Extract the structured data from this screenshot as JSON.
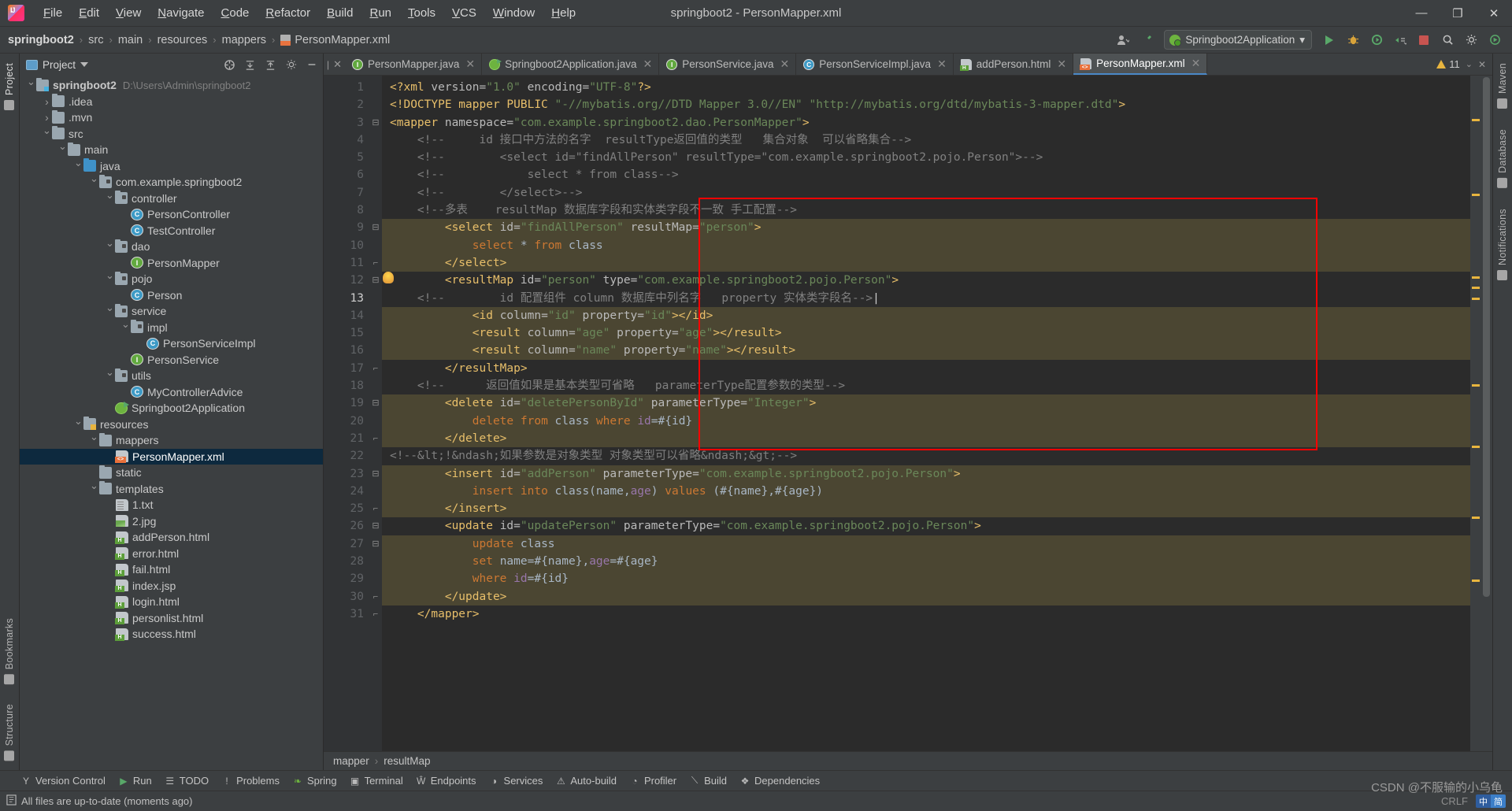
{
  "window": {
    "title": "springboot2 - PersonMapper.xml",
    "minimize": "—",
    "maximize": "❐",
    "close": "✕"
  },
  "menu": [
    "File",
    "Edit",
    "View",
    "Navigate",
    "Code",
    "Refactor",
    "Build",
    "Run",
    "Tools",
    "VCS",
    "Window",
    "Help"
  ],
  "breadcrumb": {
    "items": [
      "springboot2",
      "src",
      "main",
      "resources",
      "mappers",
      "PersonMapper.xml"
    ],
    "separator": "›"
  },
  "run_config": {
    "label": "Springboot2Application",
    "caret": "▾"
  },
  "project_pane": {
    "title": "Project",
    "caret": "▾",
    "tree": [
      {
        "depth": 0,
        "arrow": "down",
        "icon": "module",
        "label": "springboot2",
        "sub": "D:\\Users\\Admin\\springboot2",
        "bold": true
      },
      {
        "depth": 1,
        "arrow": "right",
        "icon": "folder",
        "label": ".idea"
      },
      {
        "depth": 1,
        "arrow": "right",
        "icon": "folder",
        "label": ".mvn"
      },
      {
        "depth": 1,
        "arrow": "down",
        "icon": "folder",
        "label": "src"
      },
      {
        "depth": 2,
        "arrow": "down",
        "icon": "folder",
        "label": "main"
      },
      {
        "depth": 3,
        "arrow": "down",
        "icon": "folder-blue",
        "label": "java"
      },
      {
        "depth": 4,
        "arrow": "down",
        "icon": "package",
        "label": "com.example.springboot2"
      },
      {
        "depth": 5,
        "arrow": "down",
        "icon": "package",
        "label": "controller"
      },
      {
        "depth": 6,
        "arrow": "none",
        "icon": "class",
        "label": "PersonController"
      },
      {
        "depth": 6,
        "arrow": "none",
        "icon": "class",
        "label": "TestController"
      },
      {
        "depth": 5,
        "arrow": "down",
        "icon": "package",
        "label": "dao"
      },
      {
        "depth": 6,
        "arrow": "none",
        "icon": "interface",
        "label": "PersonMapper"
      },
      {
        "depth": 5,
        "arrow": "down",
        "icon": "package",
        "label": "pojo"
      },
      {
        "depth": 6,
        "arrow": "none",
        "icon": "class",
        "label": "Person"
      },
      {
        "depth": 5,
        "arrow": "down",
        "icon": "package",
        "label": "service"
      },
      {
        "depth": 6,
        "arrow": "down",
        "icon": "package",
        "label": "impl"
      },
      {
        "depth": 7,
        "arrow": "none",
        "icon": "class",
        "label": "PersonServiceImpl"
      },
      {
        "depth": 6,
        "arrow": "none",
        "icon": "interface",
        "label": "PersonService"
      },
      {
        "depth": 5,
        "arrow": "down",
        "icon": "package",
        "label": "utils"
      },
      {
        "depth": 6,
        "arrow": "none",
        "icon": "class",
        "label": "MyControllerAdvice"
      },
      {
        "depth": 5,
        "arrow": "none",
        "icon": "spring",
        "label": "Springboot2Application"
      },
      {
        "depth": 3,
        "arrow": "down",
        "icon": "resources",
        "label": "resources"
      },
      {
        "depth": 4,
        "arrow": "down",
        "icon": "folder",
        "label": "mappers"
      },
      {
        "depth": 5,
        "arrow": "none",
        "icon": "xml",
        "label": "PersonMapper.xml",
        "selected": true
      },
      {
        "depth": 4,
        "arrow": "none",
        "icon": "folder",
        "label": "static"
      },
      {
        "depth": 4,
        "arrow": "down",
        "icon": "folder",
        "label": "templates"
      },
      {
        "depth": 5,
        "arrow": "none",
        "icon": "txt",
        "label": "1.txt"
      },
      {
        "depth": 5,
        "arrow": "none",
        "icon": "jpg",
        "label": "2.jpg"
      },
      {
        "depth": 5,
        "arrow": "none",
        "icon": "html",
        "label": "addPerson.html"
      },
      {
        "depth": 5,
        "arrow": "none",
        "icon": "html",
        "label": "error.html"
      },
      {
        "depth": 5,
        "arrow": "none",
        "icon": "html",
        "label": "fail.html"
      },
      {
        "depth": 5,
        "arrow": "none",
        "icon": "html",
        "label": "index.jsp"
      },
      {
        "depth": 5,
        "arrow": "none",
        "icon": "html",
        "label": "login.html"
      },
      {
        "depth": 5,
        "arrow": "none",
        "icon": "html",
        "label": "personlist.html"
      },
      {
        "depth": 5,
        "arrow": "none",
        "icon": "html",
        "label": "success.html"
      }
    ]
  },
  "left_rail": {
    "project": "Project",
    "bookmarks": "Bookmarks",
    "structure": "Structure"
  },
  "right_rail": {
    "maven": "Maven",
    "database": "Database",
    "notifications": "Notifications"
  },
  "tabs": [
    {
      "label": "PersonMapper.java",
      "icon": "interface",
      "icon_letter": "I",
      "active": false
    },
    {
      "label": "Springboot2Application.java",
      "icon": "spring",
      "icon_letter": "",
      "active": false
    },
    {
      "label": "PersonService.java",
      "icon": "interface",
      "icon_letter": "I",
      "active": false
    },
    {
      "label": "PersonServiceImpl.java",
      "icon": "class",
      "icon_letter": "C",
      "active": false
    },
    {
      "label": "addPerson.html",
      "icon": "html",
      "icon_letter": "",
      "active": false
    },
    {
      "label": "PersonMapper.xml",
      "icon": "xml",
      "icon_letter": "",
      "active": true
    }
  ],
  "inspection": {
    "warning_count": "11",
    "close": "✕"
  },
  "editor_breadcrumb": {
    "items": [
      "mapper",
      "resultMap"
    ],
    "separator": "›"
  },
  "code": {
    "first_line": 1,
    "lines": [
      {
        "n": 1,
        "fold": "",
        "hl": false,
        "tokens": [
          {
            "t": "<?xml ",
            "c": "c-doct"
          },
          {
            "t": "version=",
            "c": "c-attr"
          },
          {
            "t": "\"1.0\"",
            "c": "c-val"
          },
          {
            "t": " encoding=",
            "c": "c-attr"
          },
          {
            "t": "\"UTF-8\"",
            "c": "c-val"
          },
          {
            "t": "?>",
            "c": "c-doct"
          }
        ]
      },
      {
        "n": 2,
        "fold": "",
        "hl": false,
        "tokens": [
          {
            "t": "<!DOCTYPE mapper PUBLIC ",
            "c": "c-doct"
          },
          {
            "t": "\"-//mybatis.org//DTD Mapper 3.0//EN\"",
            "c": "c-val"
          },
          {
            "t": " ",
            "c": "c-plain"
          },
          {
            "t": "\"http://mybatis.org/dtd/mybatis-3-mapper.dtd\"",
            "c": "c-val"
          },
          {
            "t": ">",
            "c": "c-doct"
          }
        ]
      },
      {
        "n": 3,
        "fold": "start",
        "hl": false,
        "tokens": [
          {
            "t": "<mapper ",
            "c": "c-tag"
          },
          {
            "t": "namespace=",
            "c": "c-attr"
          },
          {
            "t": "\"com.example.springboot2.dao.PersonMapper\"",
            "c": "c-val"
          },
          {
            "t": ">",
            "c": "c-tag"
          }
        ]
      },
      {
        "n": 4,
        "fold": "",
        "hl": false,
        "tokens": [
          {
            "t": "    <!--     id 接口中方法的名字  resultType返回值的类型   集合对象  可以省略集合-->",
            "c": "c-com"
          }
        ]
      },
      {
        "n": 5,
        "fold": "",
        "hl": false,
        "tokens": [
          {
            "t": "    <!--        <select id=\"findAllPerson\" resultType=\"com.example.springboot2.pojo.Person\">-->",
            "c": "c-com"
          }
        ]
      },
      {
        "n": 6,
        "fold": "",
        "hl": false,
        "tokens": [
          {
            "t": "    <!--            select * from class-->",
            "c": "c-com"
          }
        ]
      },
      {
        "n": 7,
        "fold": "",
        "hl": false,
        "tokens": [
          {
            "t": "    <!--        </select>-->",
            "c": "c-com"
          }
        ]
      },
      {
        "n": 8,
        "fold": "",
        "hl": false,
        "tokens": [
          {
            "t": "    <!--多表    resultMap 数据库字段和实体类字段不一致 手工配置-->",
            "c": "c-com"
          }
        ]
      },
      {
        "n": 9,
        "fold": "start",
        "hl": true,
        "indent": 8,
        "tokens": [
          {
            "t": "<select ",
            "c": "c-tag"
          },
          {
            "t": "id=",
            "c": "c-attr"
          },
          {
            "t": "\"findAllPerson\"",
            "c": "c-val"
          },
          {
            "t": " resultMap=",
            "c": "c-attr"
          },
          {
            "t": "\"person\"",
            "c": "c-val"
          },
          {
            "t": ">",
            "c": "c-tag"
          }
        ]
      },
      {
        "n": 10,
        "fold": "",
        "hl": true,
        "indent": 12,
        "tokens": [
          {
            "t": "select ",
            "c": "c-sql"
          },
          {
            "t": "* ",
            "c": "c-plain"
          },
          {
            "t": "from ",
            "c": "c-sql"
          },
          {
            "t": "class",
            "c": "c-plain"
          }
        ]
      },
      {
        "n": 11,
        "fold": "end",
        "hl": true,
        "indent": 8,
        "tokens": [
          {
            "t": "</select>",
            "c": "c-tag"
          }
        ]
      },
      {
        "n": 12,
        "fold": "start",
        "hl": false,
        "indent": 8,
        "bulb": true,
        "tokens": [
          {
            "t": "<resultMap ",
            "c": "c-tag"
          },
          {
            "t": "id=",
            "c": "c-attr"
          },
          {
            "t": "\"person\"",
            "c": "c-val"
          },
          {
            "t": " type=",
            "c": "c-attr"
          },
          {
            "t": "\"com.example.springboot2.pojo.Person\"",
            "c": "c-val"
          },
          {
            "t": ">",
            "c": "c-tag"
          }
        ]
      },
      {
        "n": 13,
        "fold": "",
        "hl": false,
        "caret": true,
        "tokens": [
          {
            "t": "    <!--        id 配置组件 column 数据库中列名字   property 实体类字段名-->",
            "c": "c-com"
          }
        ]
      },
      {
        "n": 14,
        "fold": "",
        "hl": true,
        "indent": 12,
        "tokens": [
          {
            "t": "<id ",
            "c": "c-tag"
          },
          {
            "t": "column=",
            "c": "c-attr"
          },
          {
            "t": "\"id\"",
            "c": "c-val"
          },
          {
            "t": " property=",
            "c": "c-attr"
          },
          {
            "t": "\"id\"",
            "c": "c-val"
          },
          {
            "t": "></id>",
            "c": "c-tag"
          }
        ]
      },
      {
        "n": 15,
        "fold": "",
        "hl": true,
        "indent": 12,
        "tokens": [
          {
            "t": "<result ",
            "c": "c-tag"
          },
          {
            "t": "column=",
            "c": "c-attr"
          },
          {
            "t": "\"age\"",
            "c": "c-val"
          },
          {
            "t": " property=",
            "c": "c-attr"
          },
          {
            "t": "\"age\"",
            "c": "c-val"
          },
          {
            "t": "></result>",
            "c": "c-tag"
          }
        ]
      },
      {
        "n": 16,
        "fold": "",
        "hl": true,
        "indent": 12,
        "tokens": [
          {
            "t": "<result ",
            "c": "c-tag"
          },
          {
            "t": "column=",
            "c": "c-attr"
          },
          {
            "t": "\"name\"",
            "c": "c-val"
          },
          {
            "t": " property=",
            "c": "c-attr"
          },
          {
            "t": "\"name\"",
            "c": "c-val"
          },
          {
            "t": "></result>",
            "c": "c-tag"
          }
        ]
      },
      {
        "n": 17,
        "fold": "end",
        "hl": false,
        "indent": 8,
        "tokens": [
          {
            "t": "</resultMap>",
            "c": "c-tag"
          }
        ]
      },
      {
        "n": 18,
        "fold": "",
        "hl": false,
        "tokens": [
          {
            "t": "    <!--      返回值如果是基本类型可省略   parameterType配置参数的类型-->",
            "c": "c-com"
          }
        ]
      },
      {
        "n": 19,
        "fold": "start",
        "hl": true,
        "indent": 8,
        "tokens": [
          {
            "t": "<delete ",
            "c": "c-tag"
          },
          {
            "t": "id=",
            "c": "c-attr"
          },
          {
            "t": "\"deletePersonById\"",
            "c": "c-val"
          },
          {
            "t": " parameterType=",
            "c": "c-attr"
          },
          {
            "t": "\"Integer\"",
            "c": "c-val"
          },
          {
            "t": ">",
            "c": "c-tag"
          }
        ]
      },
      {
        "n": 20,
        "fold": "",
        "hl": true,
        "indent": 12,
        "tokens": [
          {
            "t": "delete ",
            "c": "c-sql"
          },
          {
            "t": "from ",
            "c": "c-sql"
          },
          {
            "t": "class ",
            "c": "c-plain"
          },
          {
            "t": "where ",
            "c": "c-sql"
          },
          {
            "t": "id",
            "c": "c-id"
          },
          {
            "t": "=#{id}",
            "c": "c-plain"
          }
        ]
      },
      {
        "n": 21,
        "fold": "end",
        "hl": true,
        "indent": 8,
        "tokens": [
          {
            "t": "</delete>",
            "c": "c-tag"
          }
        ]
      },
      {
        "n": 22,
        "fold": "",
        "hl": false,
        "tokens": [
          {
            "t": "<!--&lt;!&ndash;如果参数是对象类型 对象类型可以省略&ndash;&gt;-->",
            "c": "c-com"
          }
        ]
      },
      {
        "n": 23,
        "fold": "start",
        "hl": true,
        "indent": 8,
        "tokens": [
          {
            "t": "<insert ",
            "c": "c-tag"
          },
          {
            "t": "id=",
            "c": "c-attr"
          },
          {
            "t": "\"addPerson\"",
            "c": "c-val"
          },
          {
            "t": " parameterType=",
            "c": "c-attr"
          },
          {
            "t": "\"com.example.springboot2.pojo.Person\"",
            "c": "c-val"
          },
          {
            "t": ">",
            "c": "c-tag"
          }
        ]
      },
      {
        "n": 24,
        "fold": "",
        "hl": true,
        "indent": 12,
        "tokens": [
          {
            "t": "insert into ",
            "c": "c-sql"
          },
          {
            "t": "class(",
            "c": "c-plain"
          },
          {
            "t": "name",
            "c": "c-plain"
          },
          {
            "t": ",",
            "c": "c-plain"
          },
          {
            "t": "age",
            "c": "c-id"
          },
          {
            "t": ") ",
            "c": "c-plain"
          },
          {
            "t": "values ",
            "c": "c-sql"
          },
          {
            "t": "(#{name},#{age})",
            "c": "c-plain"
          }
        ]
      },
      {
        "n": 25,
        "fold": "end",
        "hl": true,
        "indent": 8,
        "tokens": [
          {
            "t": "</insert>",
            "c": "c-tag"
          }
        ]
      },
      {
        "n": 26,
        "fold": "start",
        "hl": false,
        "indent": 8,
        "tokens": [
          {
            "t": "<update ",
            "c": "c-tag"
          },
          {
            "t": "id=",
            "c": "c-attr"
          },
          {
            "t": "\"updatePerson\"",
            "c": "c-val"
          },
          {
            "t": " parameterType=",
            "c": "c-attr"
          },
          {
            "t": "\"com.example.springboot2.pojo.Person\"",
            "c": "c-val"
          },
          {
            "t": ">",
            "c": "c-tag"
          }
        ]
      },
      {
        "n": 27,
        "fold": "start",
        "hl": true,
        "indent": 12,
        "tokens": [
          {
            "t": "update ",
            "c": "c-sql"
          },
          {
            "t": "class",
            "c": "c-plain"
          }
        ]
      },
      {
        "n": 28,
        "fold": "",
        "hl": true,
        "indent": 12,
        "tokens": [
          {
            "t": "set ",
            "c": "c-sql"
          },
          {
            "t": "name",
            "c": "c-plain"
          },
          {
            "t": "=#{name},",
            "c": "c-plain"
          },
          {
            "t": "age",
            "c": "c-id"
          },
          {
            "t": "=#{age}",
            "c": "c-plain"
          }
        ]
      },
      {
        "n": 29,
        "fold": "",
        "hl": true,
        "indent": 12,
        "tokens": [
          {
            "t": "where ",
            "c": "c-sql"
          },
          {
            "t": "id",
            "c": "c-id"
          },
          {
            "t": "=#{id}",
            "c": "c-plain"
          }
        ]
      },
      {
        "n": 30,
        "fold": "end",
        "hl": true,
        "indent": 8,
        "tokens": [
          {
            "t": "</update>",
            "c": "c-tag"
          }
        ]
      },
      {
        "n": 31,
        "fold": "end",
        "hl": false,
        "indent": 4,
        "tokens": [
          {
            "t": "</mapper>",
            "c": "c-tag"
          }
        ]
      }
    ]
  },
  "bottom_tools": [
    {
      "label": "Version Control",
      "icon": "branch-icon"
    },
    {
      "label": "Run",
      "icon": "play-icon"
    },
    {
      "label": "TODO",
      "icon": "list-icon"
    },
    {
      "label": "Problems",
      "icon": "error-icon"
    },
    {
      "label": "Spring",
      "icon": "leaf-icon"
    },
    {
      "label": "Terminal",
      "icon": "terminal-icon"
    },
    {
      "label": "Endpoints",
      "icon": "endpoints-icon"
    },
    {
      "label": "Services",
      "icon": "services-icon"
    },
    {
      "label": "Auto-build",
      "icon": "warning-icon"
    },
    {
      "label": "Profiler",
      "icon": "profiler-icon"
    },
    {
      "label": "Build",
      "icon": "hammer-icon"
    },
    {
      "label": "Dependencies",
      "icon": "layers-icon"
    }
  ],
  "status": {
    "message": "All files are up-to-date (moments ago)",
    "ime_left": "中",
    "ime_right": "简",
    "watermark": "CSDN @不服输的小乌龟",
    "crlf": "CRLF"
  }
}
